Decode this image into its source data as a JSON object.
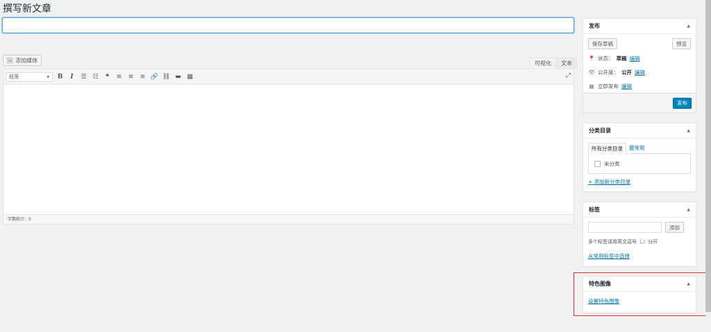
{
  "page": {
    "title": "撰写新文章"
  },
  "title_field": {
    "value": "",
    "placeholder": ""
  },
  "media": {
    "add_media_label": "添加媒体"
  },
  "editor": {
    "tabs": [
      "可视化",
      "文本"
    ],
    "format_select": "段落",
    "word_count": "字数统计：0"
  },
  "publish": {
    "title": "发布",
    "save_draft": "保存草稿",
    "preview": "预览",
    "status_label": "状态：",
    "status_value": "草稿",
    "visibility_label": "公开度：",
    "visibility_value": "公开",
    "schedule_label": "立即发布",
    "edit_link": "编辑",
    "publish_button": "发布"
  },
  "categories": {
    "title": "分类目录",
    "tab_all": "所有分类目录",
    "tab_popular": "最常用",
    "items": [
      "未分类"
    ],
    "add_new": "+ 添加新分类目录"
  },
  "tags": {
    "title": "标签",
    "add_button": "添加",
    "hint": "多个标签请用英文逗号（,）分开",
    "choose_popular": "从常用标签中选择"
  },
  "featured_image": {
    "title": "特色图像",
    "set_link": "设置特色图像"
  },
  "colors": {
    "accent": "#0085ba",
    "link": "#0073aa",
    "highlight": "#e02b2b"
  }
}
